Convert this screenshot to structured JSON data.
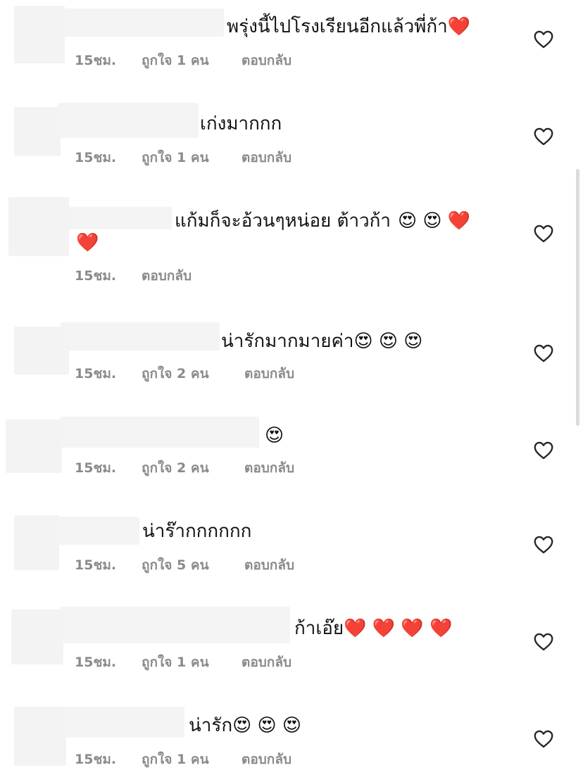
{
  "comments": [
    {
      "text": "พรุ่งนี้ไปโรงเรียนอีกแล้วพี่ก้า",
      "emoji": "❤️",
      "time": "15ชม.",
      "likes": "ถูกใจ 1 คน",
      "reply": "ตอบกลับ"
    },
    {
      "text": "เก่งมากกก",
      "emoji": "",
      "time": "15ชม.",
      "likes": "ถูกใจ 1 คน",
      "reply": "ตอบกลับ"
    },
    {
      "text": "แก้มก็จะอ้วนๆหน่อย ต้าวก้า",
      "emoji": "😍 😍 ❤️",
      "line2": "❤️",
      "time": "15ชม.",
      "likes": "",
      "reply": "ตอบกลับ"
    },
    {
      "text": "น่ารักมากมายค่า",
      "emoji": "😍 😍 😍",
      "time": "15ชม.",
      "likes": "ถูกใจ 2 คน",
      "reply": "ตอบกลับ"
    },
    {
      "text": "",
      "emoji": "😍",
      "time": "15ชม.",
      "likes": "ถูกใจ 2 คน",
      "reply": "ตอบกลับ"
    },
    {
      "text": "น่าร๊ากกกกกก",
      "emoji": "",
      "time": "15ชม.",
      "likes": "ถูกใจ 5 คน",
      "reply": "ตอบกลับ"
    },
    {
      "text": "ก้าเอ๊ย",
      "emoji": "❤️ ❤️ ❤️ ❤️",
      "time": "15ชม.",
      "likes": "ถูกใจ 1 คน",
      "reply": "ตอบกลับ"
    },
    {
      "text": "น่ารัก",
      "emoji": "😍 😍 😍",
      "time": "15ชม.",
      "likes": "ถูกใจ 1 คน",
      "reply": "ตอบกลับ"
    }
  ],
  "icons": {
    "like": "heart-outline-icon"
  },
  "colors": {
    "meta": "#8a8a8a",
    "text": "#111111",
    "heart_outline": "#262626"
  }
}
